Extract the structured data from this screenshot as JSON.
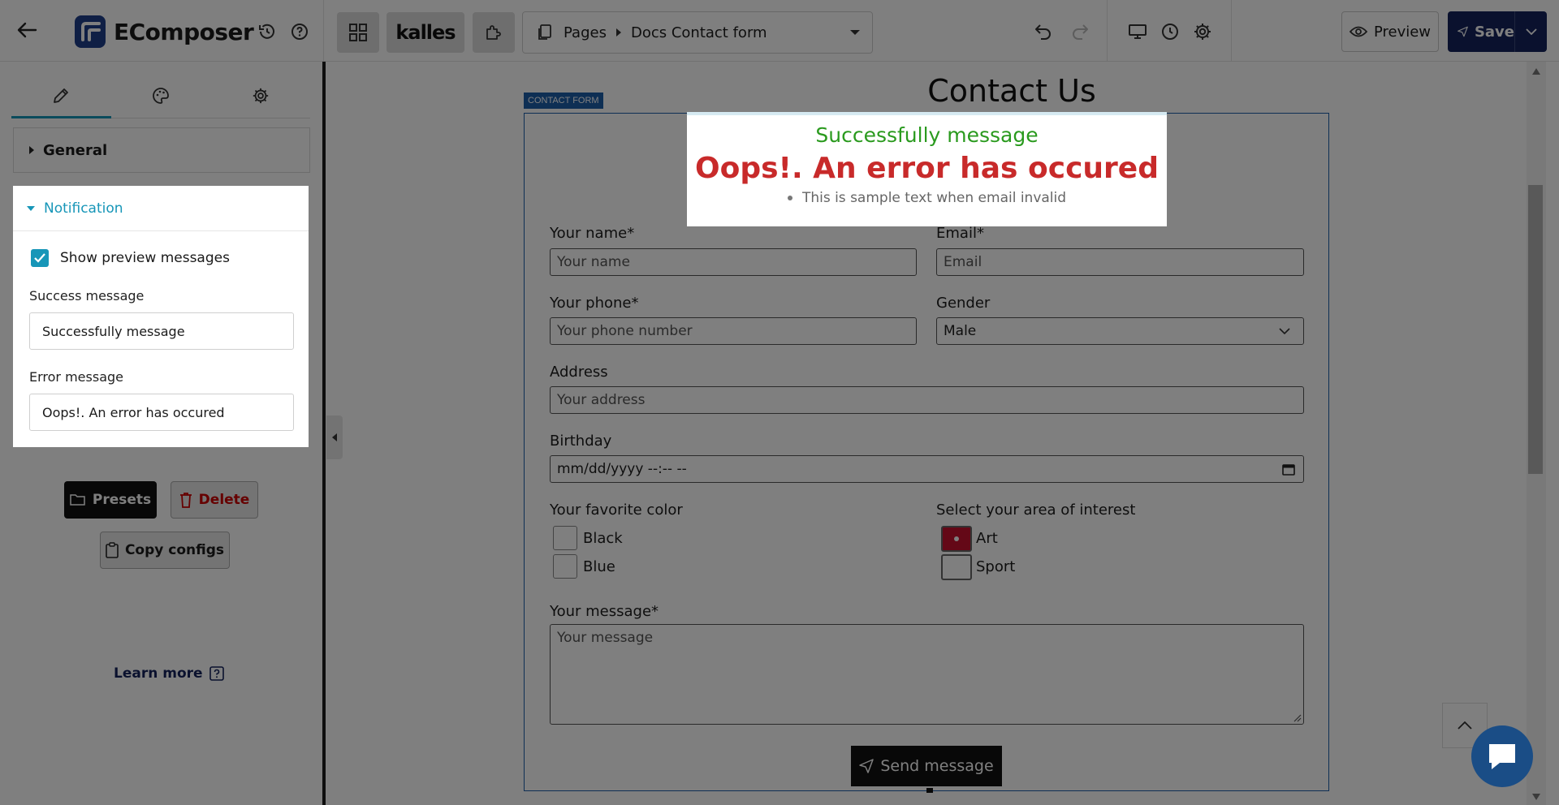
{
  "topbar": {
    "app_name": "EComposer",
    "store_name": "kalles",
    "breadcrumb_root": "Pages",
    "breadcrumb_page": "Docs Contact form",
    "preview_label": "Preview",
    "save_label": "Save"
  },
  "sidebar": {
    "general_label": "General",
    "notification_label": "Notification",
    "show_preview_label": "Show preview messages",
    "show_preview_checked": true,
    "success_label": "Success message",
    "success_value": "Successfully message",
    "error_label": "Error message",
    "error_value": "Oops!. An error has occured",
    "presets_label": "Presets",
    "delete_label": "Delete",
    "copy_label": "Copy configs",
    "learn_label": "Learn more"
  },
  "canvas": {
    "page_title": "Contact Us",
    "badge": "CONTACT FORM",
    "success_msg": "Successfully message",
    "error_msg": "Oops!. An error has occured",
    "error_item": "This is sample text when email invalid",
    "name_label": "Your name*",
    "name_ph": "Your name",
    "email_label": "Email*",
    "email_ph": "Email",
    "phone_label": "Your phone*",
    "phone_ph": "Your phone number",
    "gender_label": "Gender",
    "gender_value": "Male",
    "address_label": "Address",
    "address_ph": "Your address",
    "birthday_label": "Birthday",
    "birthday_ph": "mm/dd/yyyy --:-- --",
    "color_label": "Your favorite color",
    "color_options": [
      "Black",
      "Blue"
    ],
    "interest_label": "Select your area of interest",
    "interest_options": [
      "Art",
      "Sport"
    ],
    "message_label": "Your message*",
    "message_ph": "Your message",
    "send_label": "Send message"
  },
  "colors": {
    "accent": "#1796b8",
    "save": "#14235c",
    "success": "#2a9a1e",
    "error": "#c82a2a",
    "selected": "#c8102e"
  }
}
